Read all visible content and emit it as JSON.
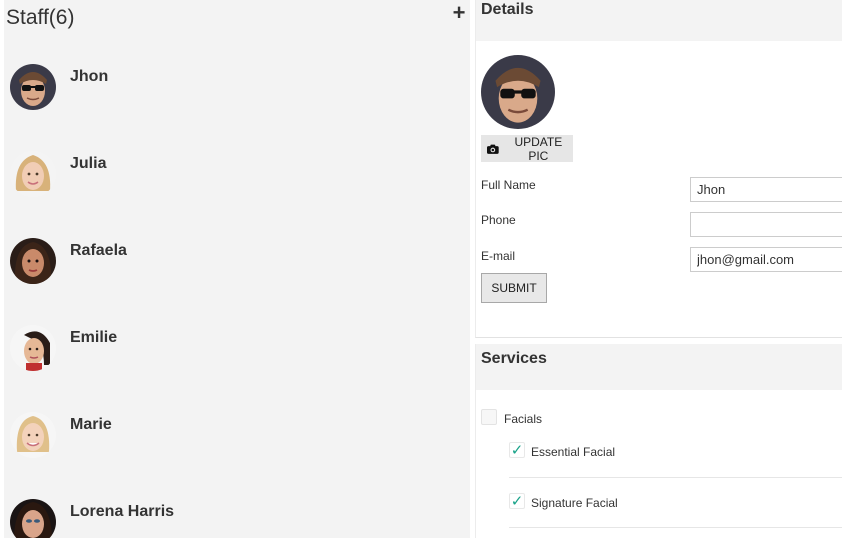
{
  "staff": {
    "title": "Staff(6)",
    "add_icon": "+",
    "members": [
      {
        "name": "Jhon"
      },
      {
        "name": "Julia"
      },
      {
        "name": "Rafaela"
      },
      {
        "name": "Emilie"
      },
      {
        "name": "Marie"
      },
      {
        "name": "Lorena Harris"
      }
    ]
  },
  "details": {
    "title": "Details",
    "update_pic_label": "UPDATE PIC",
    "full_name_label": "Full Name",
    "full_name_value": "Jhon",
    "phone_label": "Phone",
    "phone_value": "",
    "email_label": "E-mail",
    "email_value": "jhon@gmail.com",
    "submit_label": "SUBMIT"
  },
  "services": {
    "title": "Services",
    "category": {
      "label": "Facials",
      "checked": false
    },
    "items": [
      {
        "label": "Essential Facial",
        "checked": true
      },
      {
        "label": "Signature Facial",
        "checked": true
      }
    ]
  },
  "colors": {
    "panel_bg": "#f3f3f3",
    "check_accent": "#19a389"
  }
}
